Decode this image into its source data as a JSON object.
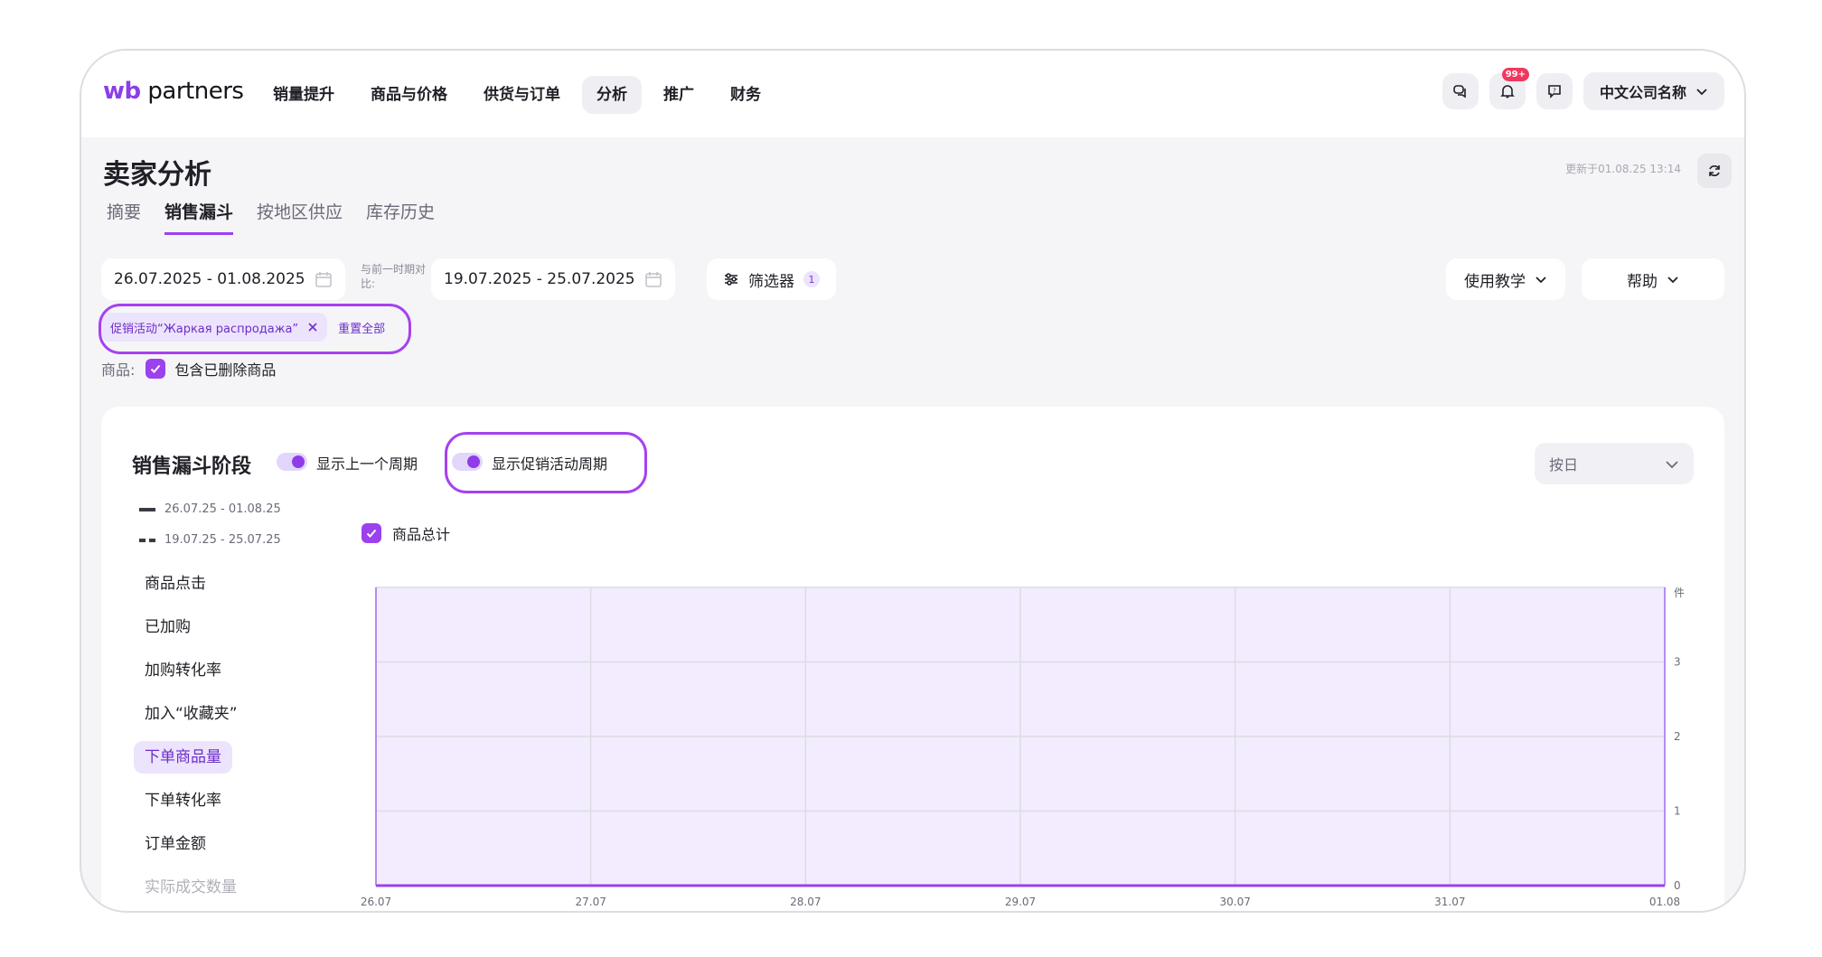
{
  "app": {
    "logo_left": "wb",
    "logo_right": " partners"
  },
  "nav": [
    {
      "label": "销量提升",
      "active": false
    },
    {
      "label": "商品与价格",
      "active": false
    },
    {
      "label": "供货与订单",
      "active": false
    },
    {
      "label": "分析",
      "active": true
    },
    {
      "label": "推广",
      "active": false
    },
    {
      "label": "财务",
      "active": false
    }
  ],
  "notifications_badge": "99+",
  "company": "中文公司名称",
  "page": {
    "title": "卖家分析",
    "updated": "更新于01.08.25 13:14"
  },
  "tabs": [
    {
      "label": "摘要",
      "active": false
    },
    {
      "label": "销售漏斗",
      "active": true
    },
    {
      "label": "按地区供应",
      "active": false
    },
    {
      "label": "库存历史",
      "active": false
    }
  ],
  "filters": {
    "period": "26.07.2025 - 01.08.2025",
    "compare_label": "与前一时期对比:",
    "compare_period": "19.07.2025 - 25.07.2025",
    "filter_label": "筛选器",
    "filter_count": "1",
    "tutorial_label": "使用教学",
    "help_label": "帮助",
    "chip_label": "促销活动“Жаркая распродажа”",
    "reset_label": "重置全部",
    "goods_label": "商品:",
    "include_deleted_label": "包含已删除商品"
  },
  "funnel": {
    "title": "销售漏斗阶段",
    "toggle_prev_label": "显示上一个周期",
    "toggle_promo_label": "显示促销活动周期",
    "granularity": "按日",
    "legend_current": "26.07.25 - 01.08.25",
    "legend_previous": "19.07.25 - 25.07.25",
    "total_label": "商品总计",
    "metrics": [
      {
        "label": "商品点击",
        "state": "normal"
      },
      {
        "label": "已加购",
        "state": "normal"
      },
      {
        "label": "加购转化率",
        "state": "normal"
      },
      {
        "label": "加入“收藏夹”",
        "state": "normal"
      },
      {
        "label": "下单商品量",
        "state": "active"
      },
      {
        "label": "下单转化率",
        "state": "normal"
      },
      {
        "label": "订单金额",
        "state": "normal"
      },
      {
        "label": "实际成交数量",
        "state": "faded"
      }
    ]
  },
  "chart_data": {
    "type": "line",
    "x": [
      "26.07",
      "27.07",
      "28.07",
      "29.07",
      "30.07",
      "31.07",
      "01.08"
    ],
    "y_ticks": [
      0,
      1,
      2,
      3
    ],
    "ylim": [
      0,
      4
    ],
    "y_unit": "件",
    "grid": true,
    "series": [
      {
        "values": [
          0,
          0,
          0,
          0,
          0,
          0,
          0
        ],
        "color": "#9b41ee"
      }
    ],
    "promo_period_highlight": {
      "from": "26.07",
      "to": "01.08",
      "color": "#f3ecfe"
    }
  }
}
